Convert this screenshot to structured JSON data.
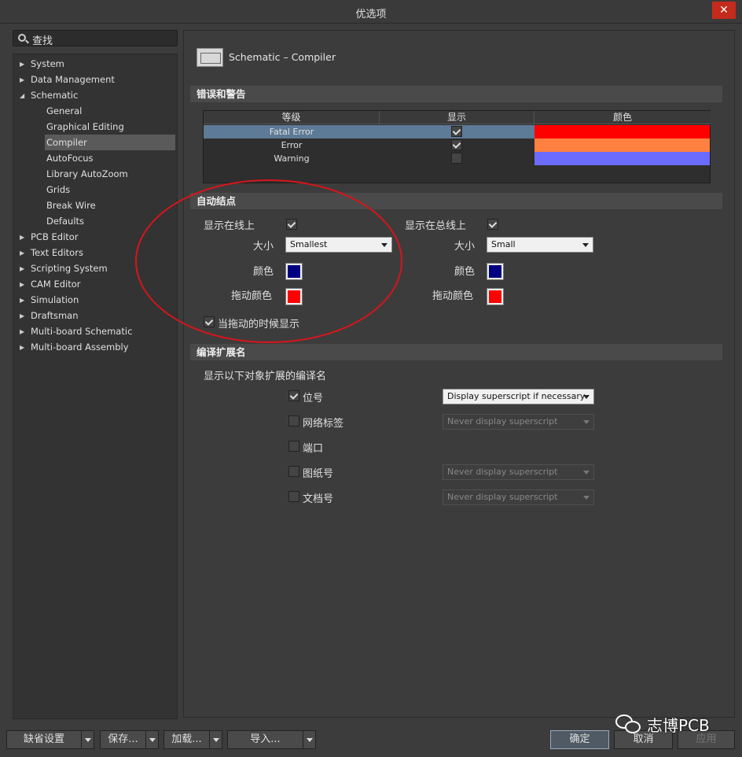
{
  "window": {
    "title": "优选项",
    "close_glyph": "✕"
  },
  "search": {
    "label": "查找"
  },
  "tree": [
    {
      "label": "System",
      "level": 0,
      "arrow": "▶"
    },
    {
      "label": "Data Management",
      "level": 0,
      "arrow": "▶"
    },
    {
      "label": "Schematic",
      "level": 0,
      "arrow": "◢"
    },
    {
      "label": "General",
      "level": 1
    },
    {
      "label": "Graphical Editing",
      "level": 1
    },
    {
      "label": "Compiler",
      "level": 1,
      "selected": true
    },
    {
      "label": "AutoFocus",
      "level": 1
    },
    {
      "label": "Library AutoZoom",
      "level": 1
    },
    {
      "label": "Grids",
      "level": 1
    },
    {
      "label": "Break Wire",
      "level": 1
    },
    {
      "label": "Defaults",
      "level": 1
    },
    {
      "label": "PCB Editor",
      "level": 0,
      "arrow": "▶"
    },
    {
      "label": "Text Editors",
      "level": 0,
      "arrow": "▶"
    },
    {
      "label": "Scripting System",
      "level": 0,
      "arrow": "▶"
    },
    {
      "label": "CAM Editor",
      "level": 0,
      "arrow": "▶"
    },
    {
      "label": "Simulation",
      "level": 0,
      "arrow": "▶"
    },
    {
      "label": "Draftsman",
      "level": 0,
      "arrow": "▶"
    },
    {
      "label": "Multi-board Schematic",
      "level": 0,
      "arrow": "▶"
    },
    {
      "label": "Multi-board Assembly",
      "level": 0,
      "arrow": "▶"
    }
  ],
  "page": {
    "title": "Schematic – Compiler"
  },
  "errors": {
    "section_title": "错误和警告",
    "headers": [
      "等级",
      "显示",
      "颜色"
    ],
    "rows": [
      {
        "level": "Fatal Error",
        "show": true,
        "color": "#ff0000",
        "selected": true
      },
      {
        "level": "Error",
        "show": true,
        "color": "#ff8040"
      },
      {
        "level": "Warning",
        "show": false,
        "color": "#6b6bff"
      }
    ]
  },
  "junctions": {
    "section_title": "自动结点",
    "wire": {
      "label": "显示在线上",
      "checked": true,
      "size_label": "大小",
      "size_value": "Smallest",
      "color_label": "颜色",
      "color": "#000080",
      "drag_label": "拖动颜色",
      "drag_color": "#ff0000"
    },
    "bus": {
      "label": "显示在总线上",
      "checked": true,
      "size_label": "大小",
      "size_value": "Small",
      "color_label": "颜色",
      "color": "#000080",
      "drag_label": "拖动颜色",
      "drag_color": "#ff0000"
    },
    "drag_show": {
      "label": "当拖动的时候显示",
      "checked": true
    }
  },
  "compiled": {
    "section_title": "编译扩展名",
    "subtitle": "显示以下对象扩展的编译名",
    "items": [
      {
        "label": "位号",
        "checked": true,
        "option": "Display superscript if necessary",
        "enabled": true
      },
      {
        "label": "网络标签",
        "checked": false,
        "option": "Never display superscript",
        "enabled": false
      },
      {
        "label": "端口",
        "checked": false,
        "option": null,
        "enabled": false
      },
      {
        "label": "图纸号",
        "checked": false,
        "option": "Never display superscript",
        "enabled": false
      },
      {
        "label": "文档号",
        "checked": false,
        "option": "Never display superscript",
        "enabled": false
      }
    ]
  },
  "footer": {
    "defaults": "缺省设置",
    "save": "保存...",
    "load": "加载...",
    "import": "导入...",
    "ok": "确定",
    "cancel": "取消",
    "apply": "应用"
  },
  "watermark": {
    "text": "志博PCB"
  },
  "colors": {
    "accent_ring": "#d9141b",
    "selected_row": "#5d7a96"
  }
}
